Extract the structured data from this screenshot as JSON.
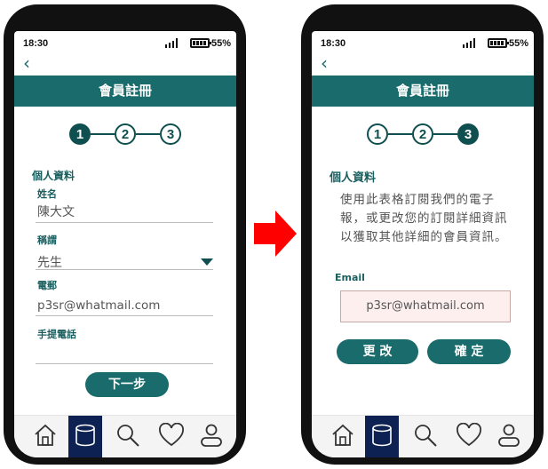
{
  "left": {
    "status": {
      "time": "18:30",
      "battery": "55%"
    },
    "title": "會員註冊",
    "steps": [
      "1",
      "2",
      "3"
    ],
    "section": "個人資料",
    "fields": {
      "name_label": "姓名",
      "name_value": "陳大文",
      "title_label": "稱謂",
      "title_value": "先生",
      "email_label": "電郵",
      "email_value": "p3sr@whatmail.com",
      "phone_label": "手提電話"
    },
    "next_label": "下一步"
  },
  "right": {
    "status": {
      "time": "18:30",
      "battery": "55%"
    },
    "title": "會員註冊",
    "steps": [
      "1",
      "2",
      "3"
    ],
    "section": "個人資料",
    "description": "使用此表格訂閱我們的電子報，或更改您的訂閱詳細資訊以獲取其他詳細的會員資訊。",
    "email_label": "Email",
    "email_value": "p3sr@whatmail.com",
    "change_label": "更 改",
    "confirm_label": "確 定"
  },
  "nav": [
    "home-icon",
    "database-icon",
    "search-icon",
    "heart-icon",
    "user-icon"
  ],
  "colors": {
    "teal": "#1a6b6b",
    "nav_active": "#0d2152",
    "arrow": "#ff0000"
  }
}
